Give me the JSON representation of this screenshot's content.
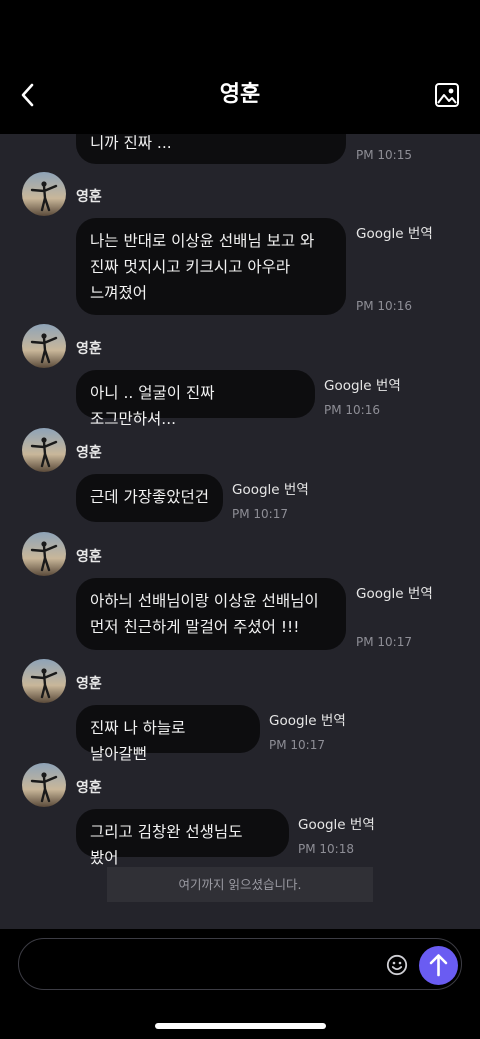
{
  "header": {
    "title": "영훈"
  },
  "messages": [
    {
      "sender": "",
      "text": "니까 진짜 ...",
      "translate": "",
      "time": "PM 10:15"
    },
    {
      "sender": "영훈",
      "text": "나는 반대로 이상윤 선배님 보고 와 진짜 멋지시고 키크시고 아우라 느껴졌어",
      "translate": "Google 번역",
      "time": "PM 10:16"
    },
    {
      "sender": "영훈",
      "text": "아니 .. 얼굴이 진짜 조그만하셔...",
      "translate": "Google 번역",
      "time": "PM 10:16"
    },
    {
      "sender": "영훈",
      "text": "근데 가장좋았던건",
      "translate": "Google 번역",
      "time": "PM 10:17"
    },
    {
      "sender": "영훈",
      "text": "아하늬 선배님이랑 이상윤 선배님이 먼저 친근하게 말걸어 주셨어 !!!",
      "translate": "Google 번역",
      "time": "PM 10:17"
    },
    {
      "sender": "영훈",
      "text": "진짜 나 하늘로 날아갈뻔",
      "translate": "Google 번역",
      "time": "PM 10:17"
    },
    {
      "sender": "영훈",
      "text": "그리고 김창완 선생님도 봤어",
      "translate": "Google 번역",
      "time": "PM 10:18"
    }
  ],
  "read_banner": "여기까지 읽으셨습니다.",
  "composer": {
    "value": "",
    "placeholder": ""
  },
  "icons": {
    "back": "chevron-left-icon",
    "gallery": "image-icon",
    "emoji": "smiley-icon",
    "send": "arrow-up-icon"
  },
  "colors": {
    "accent": "#6a5cf2",
    "chat_bg": "#24242b",
    "bubble_bg": "#0d0d0f"
  }
}
